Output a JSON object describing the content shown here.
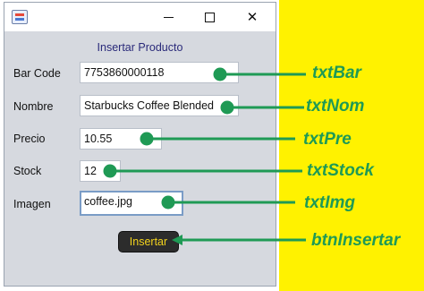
{
  "form": {
    "title": "Insertar Producto",
    "fields": [
      {
        "label": "Bar Code",
        "value": "7753860000118"
      },
      {
        "label": "Nombre",
        "value": "Starbucks Coffee Blended"
      },
      {
        "label": "Precio",
        "value": "10.55"
      },
      {
        "label": "Stock",
        "value": "12"
      },
      {
        "label": "Imagen",
        "value": "coffee.jpg"
      }
    ],
    "button_label": "Insertar"
  },
  "annotations": {
    "txtBar": "txtBar",
    "txtNom": "txtNom",
    "txtPre": "txtPre",
    "txtStock": "txtStock",
    "txtImg": "txtImg",
    "btnInsertar": "btnInsertar"
  },
  "colors": {
    "annotation_green": "#1f9a55",
    "yellow_panel": "#fff200",
    "button_text": "#f2d21d"
  },
  "icons": {
    "app": "java-app-icon",
    "minimize": "minimize-icon",
    "maximize": "maximize-icon",
    "close": "close-icon"
  }
}
